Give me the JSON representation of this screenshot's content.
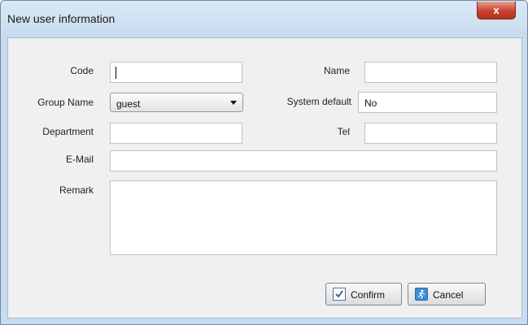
{
  "window": {
    "title": "New user information",
    "close_glyph": "x"
  },
  "form": {
    "code": {
      "label": "Code",
      "value": ""
    },
    "name": {
      "label": "Name",
      "value": ""
    },
    "group_name": {
      "label": "Group Name",
      "selected": "guest"
    },
    "system_default": {
      "label": "System default",
      "value": "No"
    },
    "department": {
      "label": "Department",
      "value": ""
    },
    "tel": {
      "label": "Tel",
      "value": ""
    },
    "email": {
      "label": "E-Mail",
      "value": ""
    },
    "remark": {
      "label": "Remark",
      "value": ""
    }
  },
  "buttons": {
    "confirm": {
      "label": "Confirm",
      "icon": "check-icon"
    },
    "cancel": {
      "label": "Cancel",
      "icon": "exit-runner-icon"
    }
  }
}
